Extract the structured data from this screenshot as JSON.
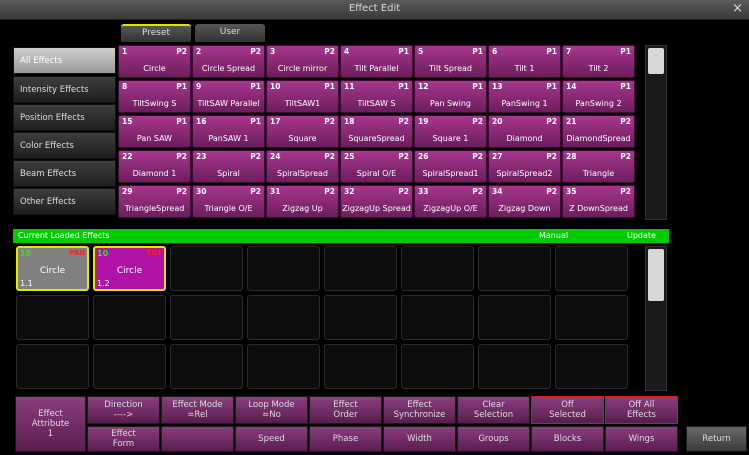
{
  "window": {
    "title": "Effect Edit",
    "close_glyph": "×"
  },
  "tabs": [
    {
      "label": "Preset",
      "active": true
    },
    {
      "label": "User",
      "active": false
    }
  ],
  "categories": [
    {
      "label": "All Effects",
      "active": true
    },
    {
      "label": "Intensity Effects",
      "active": false
    },
    {
      "label": "Position Effects",
      "active": false
    },
    {
      "label": "Color Effects",
      "active": false
    },
    {
      "label": "Beam Effects",
      "active": false
    },
    {
      "label": "Other Effects",
      "active": false
    }
  ],
  "effects": [
    {
      "num": "1",
      "page": "P2",
      "name": "Circle"
    },
    {
      "num": "2",
      "page": "P2",
      "name": "Circle Spread"
    },
    {
      "num": "3",
      "page": "P2",
      "name": "Circle mirror"
    },
    {
      "num": "4",
      "page": "P1",
      "name": "Tilt Parallel"
    },
    {
      "num": "5",
      "page": "P1",
      "name": "Tilt Spread"
    },
    {
      "num": "6",
      "page": "P1",
      "name": "Tilt 1"
    },
    {
      "num": "7",
      "page": "P1",
      "name": "Tilt 2"
    },
    {
      "num": "8",
      "page": "P1",
      "name": "TiltSwing S"
    },
    {
      "num": "9",
      "page": "P1",
      "name": "TiltSAW Parallel"
    },
    {
      "num": "10",
      "page": "P1",
      "name": "TiltSAW1"
    },
    {
      "num": "11",
      "page": "P1",
      "name": "TiltSAW S"
    },
    {
      "num": "12",
      "page": "P1",
      "name": "Pan Swing"
    },
    {
      "num": "13",
      "page": "P1",
      "name": "PanSwing 1"
    },
    {
      "num": "14",
      "page": "P1",
      "name": "PanSwing 2"
    },
    {
      "num": "15",
      "page": "P1",
      "name": "Pan SAW"
    },
    {
      "num": "16",
      "page": "P1",
      "name": "PanSAW 1"
    },
    {
      "num": "17",
      "page": "P2",
      "name": "Square"
    },
    {
      "num": "18",
      "page": "P2",
      "name": "SquareSpread"
    },
    {
      "num": "19",
      "page": "P2",
      "name": "Square 1"
    },
    {
      "num": "20",
      "page": "P2",
      "name": "Diamond"
    },
    {
      "num": "21",
      "page": "P2",
      "name": "DiamondSpread"
    },
    {
      "num": "22",
      "page": "P2",
      "name": "Diamond 1"
    },
    {
      "num": "23",
      "page": "P2",
      "name": "Spiral"
    },
    {
      "num": "24",
      "page": "P2",
      "name": "SpiralSpread"
    },
    {
      "num": "25",
      "page": "P2",
      "name": "Spiral O/E"
    },
    {
      "num": "26",
      "page": "P2",
      "name": "SpiralSpread1"
    },
    {
      "num": "27",
      "page": "P2",
      "name": "SpiralSpread2"
    },
    {
      "num": "28",
      "page": "P2",
      "name": "Triangle"
    },
    {
      "num": "29",
      "page": "P2",
      "name": "TriangleSpread"
    },
    {
      "num": "30",
      "page": "P2",
      "name": "Triangle O/E"
    },
    {
      "num": "31",
      "page": "P2",
      "name": "Zigzag Up"
    },
    {
      "num": "32",
      "page": "P2",
      "name": "ZigzagUp Spread"
    },
    {
      "num": "33",
      "page": "P2",
      "name": "ZigzagUp O/E"
    },
    {
      "num": "34",
      "page": "P2",
      "name": "Zigzag Down"
    },
    {
      "num": "35",
      "page": "P2",
      "name": "Z DownSpread"
    }
  ],
  "loaded": {
    "header": "Current Loaded Effects",
    "mode": "Manual",
    "update": "Update",
    "cells": [
      {
        "n": "10",
        "tag": "PAN",
        "name": "Circle",
        "id": "1.1",
        "color": "gray"
      },
      {
        "n": "10",
        "tag": "TILT",
        "name": "Circle",
        "id": "1.2",
        "color": "purple"
      }
    ]
  },
  "bottom": {
    "effect_attribute": "Effect\nAttribute\n1",
    "row1": [
      {
        "label": "Direction\n---->",
        "red": false
      },
      {
        "label": "Effect Mode\n=Rel",
        "red": false
      },
      {
        "label": "Loop Mode\n=No",
        "red": false
      },
      {
        "label": "Effect\nOrder",
        "red": false
      },
      {
        "label": "Effect\nSynchronize",
        "red": false
      },
      {
        "label": "Clear\nSelection",
        "red": false
      },
      {
        "label": "Off\nSelected",
        "red": true
      },
      {
        "label": "Off All\nEffects",
        "red": true
      }
    ],
    "row2": [
      {
        "label": "Effect\nForm"
      },
      {
        "label": ""
      },
      {
        "label": "Speed"
      },
      {
        "label": "Phase"
      },
      {
        "label": "Width"
      },
      {
        "label": "Groups"
      },
      {
        "label": "Blocks"
      },
      {
        "label": "Wings"
      }
    ],
    "return_label": "Return"
  }
}
